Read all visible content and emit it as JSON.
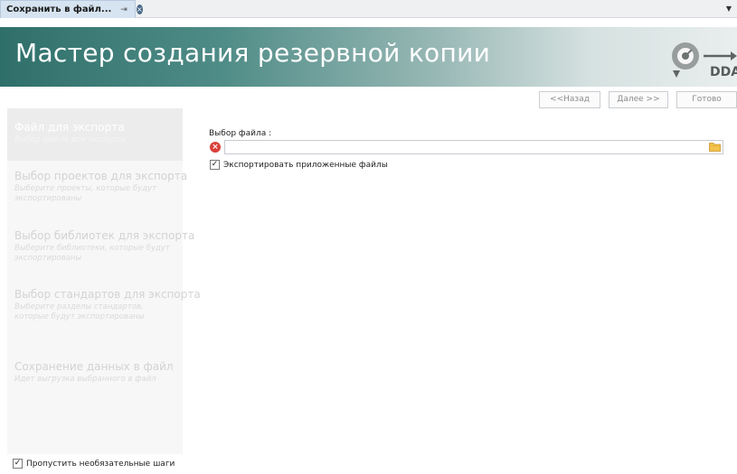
{
  "tab": {
    "title": "Сохранить в файл...",
    "pin_icon": "pin-icon",
    "close_icon": "close-icon"
  },
  "banner": {
    "title": "Мастер создания резервной копии",
    "logo_text": "DDA"
  },
  "nav": {
    "back": "<<Назад",
    "next": "Далее >>",
    "done": "Готово"
  },
  "steps": [
    {
      "title": "Файл для экспорта",
      "desc": "Выбор файла для экспорта",
      "active": true
    },
    {
      "title": "Выбор проектов для экспорта",
      "desc": "Выберите проекты, которые будут экспортированы",
      "active": false
    },
    {
      "title": "Выбор библиотек для экспорта",
      "desc": "Выберите библиотеки, которые будут экспортированы",
      "active": false
    },
    {
      "title": "Выбор стандартов для экспорта",
      "desc": "Выберите разделы стандартов, которые будут экспортированы",
      "active": false
    },
    {
      "title": "Сохранение данных в файл",
      "desc": "Идет выгрузка выбранного в файл",
      "active": false
    }
  ],
  "form": {
    "file_label": "Выбор файла :",
    "file_value": "",
    "export_attached_label": "Экспортировать приложенные файлы",
    "export_attached_checked": "✓"
  },
  "footer": {
    "skip_label": "Пропустить необязательные шаги",
    "skip_checked": "✓"
  },
  "colors": {
    "banner_start": "#2f6f6a",
    "banner_end": "#e9eeee",
    "error": "#d9403a",
    "tab_active": "#d6e3f1"
  }
}
